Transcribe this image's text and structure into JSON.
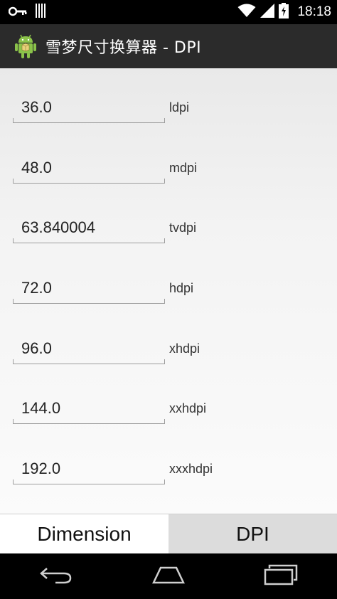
{
  "status_bar": {
    "time": "18:18",
    "icons": [
      "key-icon",
      "barcode-icon",
      "wifi-icon",
      "signal-icon",
      "battery-icon"
    ]
  },
  "action_bar": {
    "title": "雪梦尺寸换算器 - DPI",
    "icon": "android-icon"
  },
  "rows": [
    {
      "value": "36.0",
      "label": "ldpi"
    },
    {
      "value": "48.0",
      "label": "mdpi"
    },
    {
      "value": "63.840004",
      "label": "tvdpi"
    },
    {
      "value": "72.0",
      "label": "hdpi"
    },
    {
      "value": "96.0",
      "label": "xhdpi"
    },
    {
      "value": "144.0",
      "label": "xxhdpi"
    },
    {
      "value": "192.0",
      "label": "xxxhdpi"
    }
  ],
  "tabs": [
    {
      "label": "Dimension",
      "selected": false
    },
    {
      "label": "DPI",
      "selected": true
    }
  ],
  "nav_bar": {
    "buttons": [
      "back-icon",
      "home-icon",
      "recents-icon"
    ]
  }
}
